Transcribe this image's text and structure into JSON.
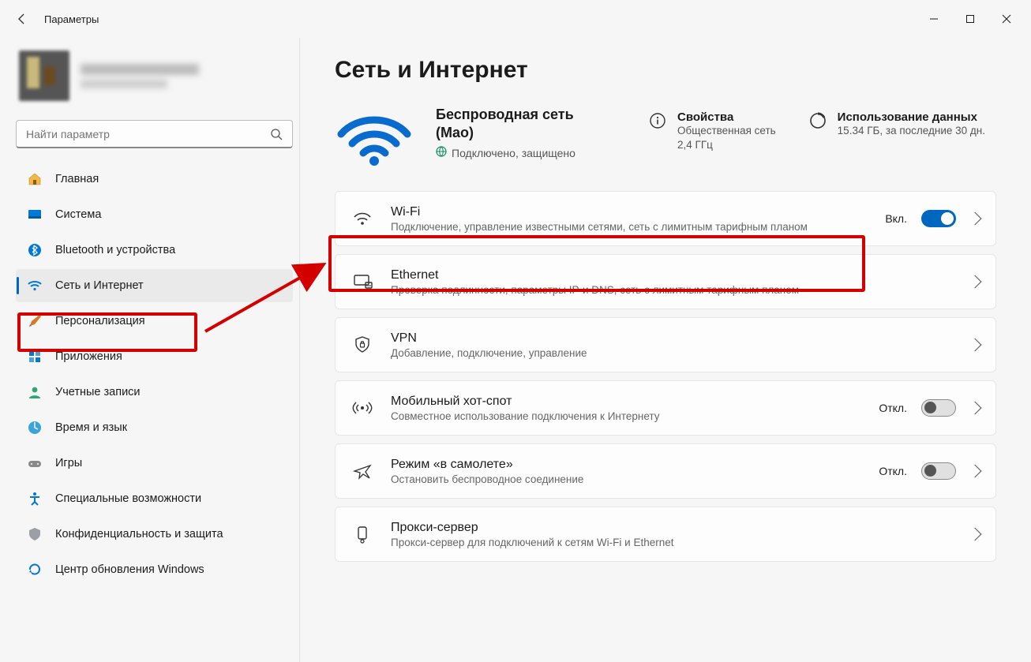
{
  "window": {
    "title": "Параметры"
  },
  "search": {
    "placeholder": "Найти параметр"
  },
  "nav": {
    "home": "Главная",
    "system": "Система",
    "bluetooth": "Bluetooth и устройства",
    "network": "Сеть и Интернет",
    "personalization": "Персонализация",
    "apps": "Приложения",
    "accounts": "Учетные записи",
    "time": "Время и язык",
    "gaming": "Игры",
    "accessibility": "Специальные возможности",
    "privacy": "Конфиденциальность и защита",
    "update": "Центр обновления Windows"
  },
  "page": {
    "title": "Сеть и Интернет"
  },
  "connection": {
    "heading_line1": "Беспроводная сеть",
    "heading_line2": "(Mao)",
    "status": "Подключено, защищено"
  },
  "properties": {
    "title": "Свойства",
    "line1": "Общественная сеть",
    "line2": "2,4 ГГц"
  },
  "data_usage": {
    "title": "Использование данных",
    "line1": "15.34 ГБ, за последние 30 дн."
  },
  "cards": {
    "wifi": {
      "title": "Wi-Fi",
      "desc": "Подключение, управление известными сетями, сеть с лимитным тарифным планом",
      "state": "Вкл."
    },
    "ethernet": {
      "title": "Ethernet",
      "desc": "Проверка подлинности, параметры IP-и DNS, сеть с лимитным тарифным планом"
    },
    "vpn": {
      "title": "VPN",
      "desc": "Добавление, подключение, управление"
    },
    "hotspot": {
      "title": "Мобильный хот-спот",
      "desc": "Совместное использование подключения к Интернету",
      "state": "Откл."
    },
    "airplane": {
      "title": "Режим «в самолете»",
      "desc": "Остановить беспроводное соединение",
      "state": "Откл."
    },
    "proxy": {
      "title": "Прокси-сервер",
      "desc": "Прокси-сервер для подключений к сетям Wi-Fi и Ethernet"
    }
  }
}
